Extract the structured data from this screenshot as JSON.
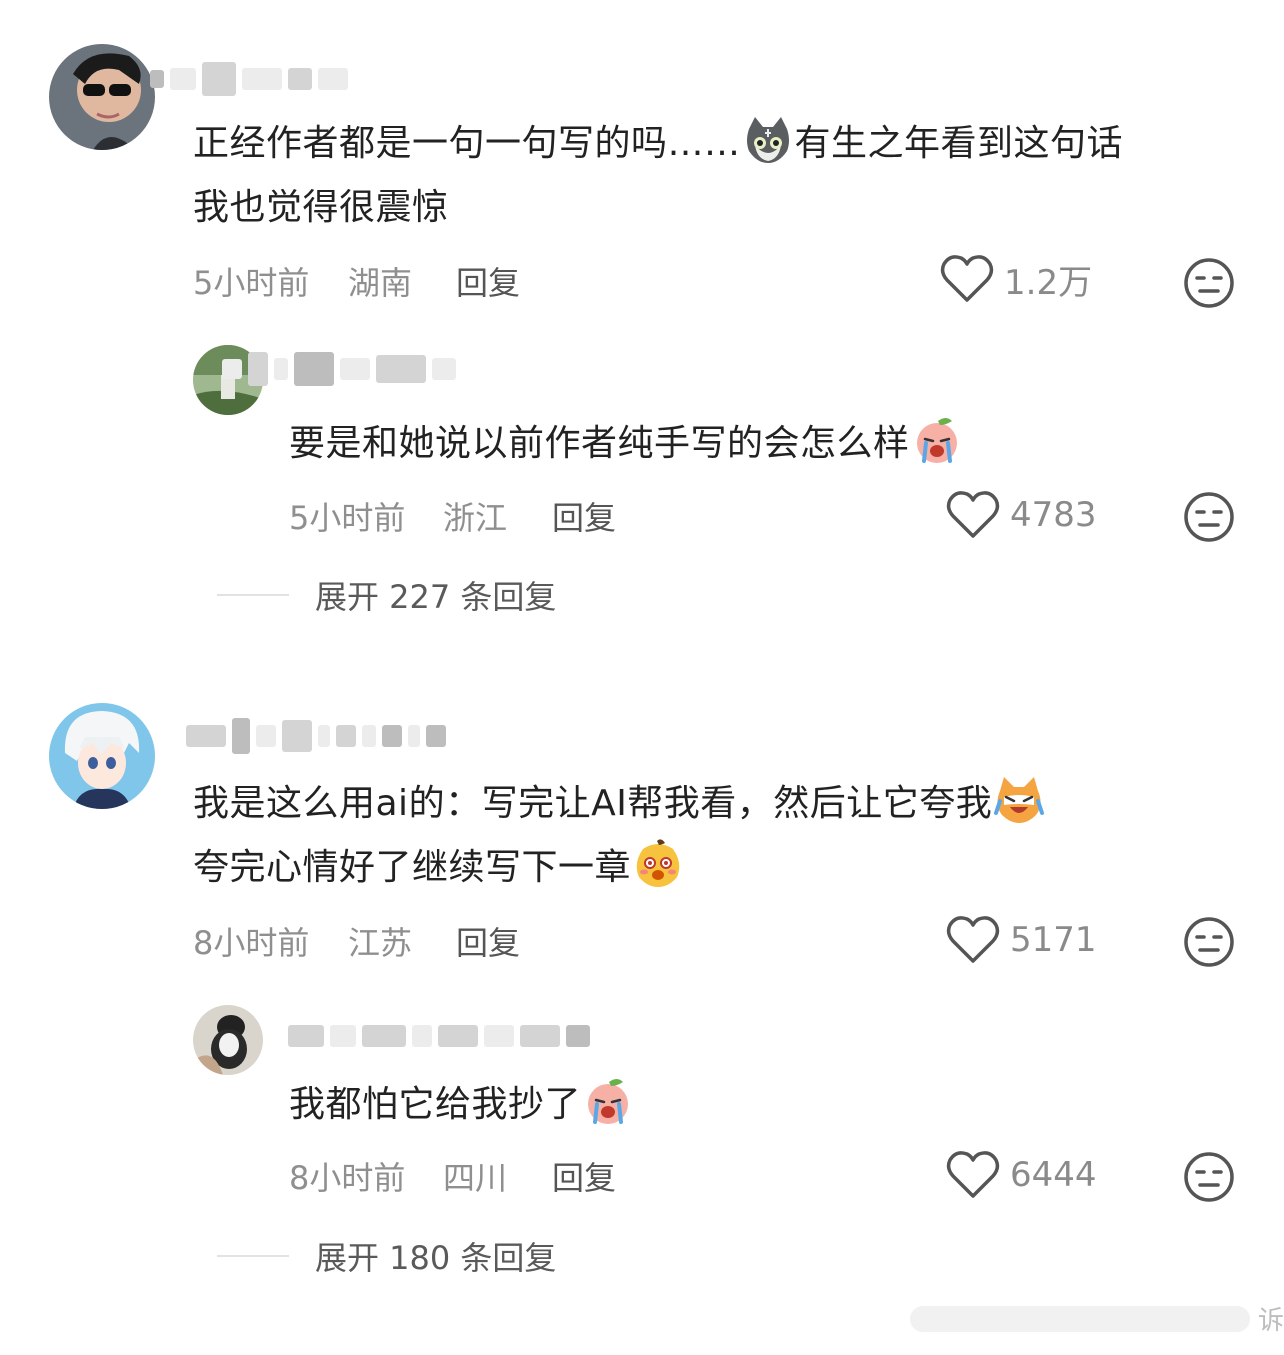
{
  "comments": [
    {
      "text_lines": [
        "正经作者都是一句一句写的吗……",
        "有生之年看到这句话",
        "我也觉得很震惊"
      ],
      "emojis": [
        "cat-face-emoji"
      ],
      "time": "5小时前",
      "location": "湖南",
      "reply_label": "回复",
      "likes": "1.2万",
      "reply": {
        "text": "要是和她说以前作者纯手写的会怎么样",
        "emojis": [
          "crying-peach-emoji"
        ],
        "time": "5小时前",
        "location": "浙江",
        "reply_label": "回复",
        "likes": "4783"
      },
      "expand_label": "展开 227 条回复"
    },
    {
      "text_lines": [
        "我是这么用ai的：写完让AI帮我看，然后让它夸我",
        "夸完心情好了继续写下一章"
      ],
      "emojis": [
        "laughing-cat-emoji",
        "happy-blush-emoji"
      ],
      "time": "8小时前",
      "location": "江苏",
      "reply_label": "回复",
      "likes": "5171",
      "reply": {
        "text": "我都怕它给我抄了",
        "emojis": [
          "crying-peach-emoji"
        ],
        "time": "8小时前",
        "location": "四川",
        "reply_label": "回复",
        "likes": "6444"
      },
      "expand_label": "展开 180 条回复"
    }
  ],
  "watermark_text": "诉",
  "colors": {
    "meta": "#8f8f8f",
    "text": "#222222",
    "heart": "#555555"
  }
}
